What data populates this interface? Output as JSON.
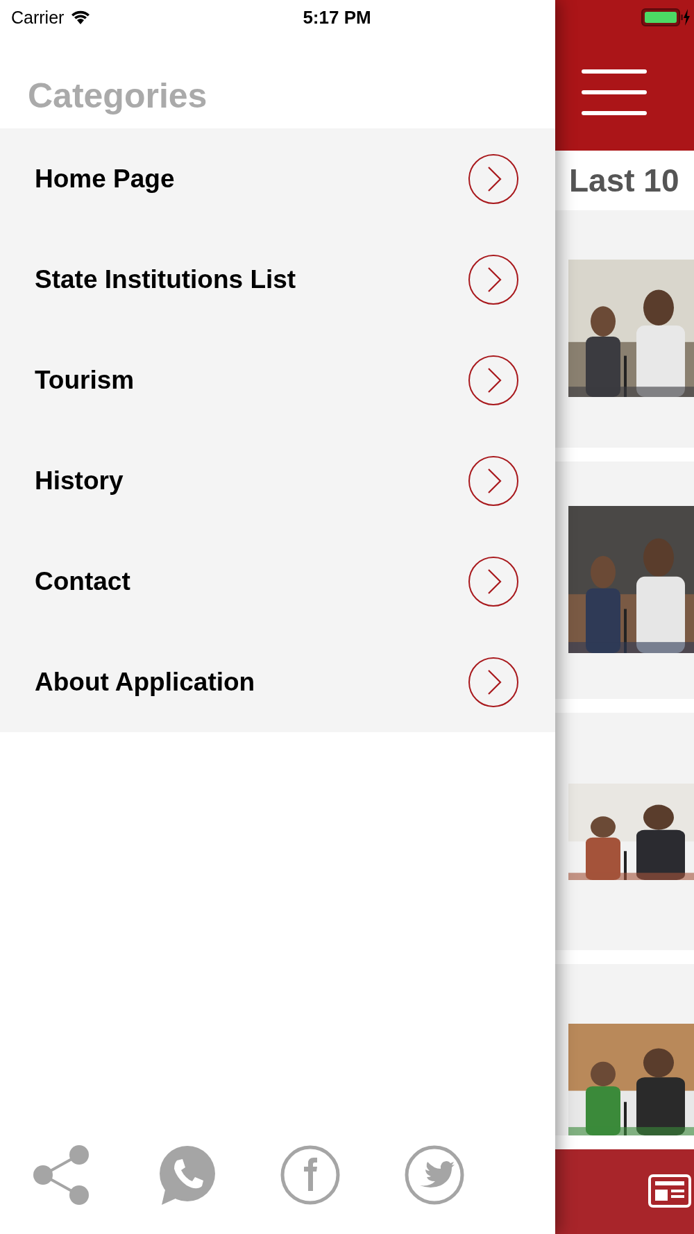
{
  "status_bar": {
    "carrier": "Carrier",
    "time": "5:17 PM"
  },
  "drawer": {
    "title": "Categories",
    "items": [
      {
        "label": "Home Page"
      },
      {
        "label": "State Institutions List"
      },
      {
        "label": "Tourism"
      },
      {
        "label": "History"
      },
      {
        "label": "Contact"
      },
      {
        "label": "About Application"
      }
    ]
  },
  "main": {
    "section_title": "Last 10"
  }
}
